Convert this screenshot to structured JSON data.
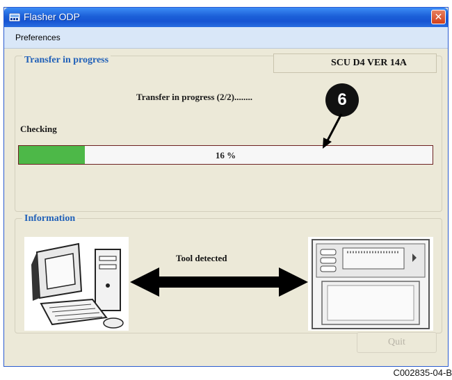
{
  "window": {
    "title": "Flasher ODP",
    "close_glyph": "✕"
  },
  "menu": {
    "items": [
      "Preferences"
    ]
  },
  "transfer_group": {
    "title": "Transfer in progress",
    "tool_id": "SCU D4 VER  14A",
    "status": "Transfer in progress (2/2)........",
    "step_label": "Checking",
    "progress_text": "16 %",
    "progress_fraction": 0.16,
    "progress_color": "#4db848"
  },
  "callout": {
    "number": "6"
  },
  "info_group": {
    "title": "Information",
    "message": "Tool detected",
    "left_icon": "computer-icon",
    "right_icon": "thermostat-device-icon",
    "link_icon": "double-arrow-icon"
  },
  "buttons": {
    "quit": "Quit"
  },
  "figure_code": "C002835-04-B",
  "colors": {
    "title_blue": "#1b5fd8",
    "group_title": "#2060b8",
    "panel_bg": "#ece9d8"
  }
}
